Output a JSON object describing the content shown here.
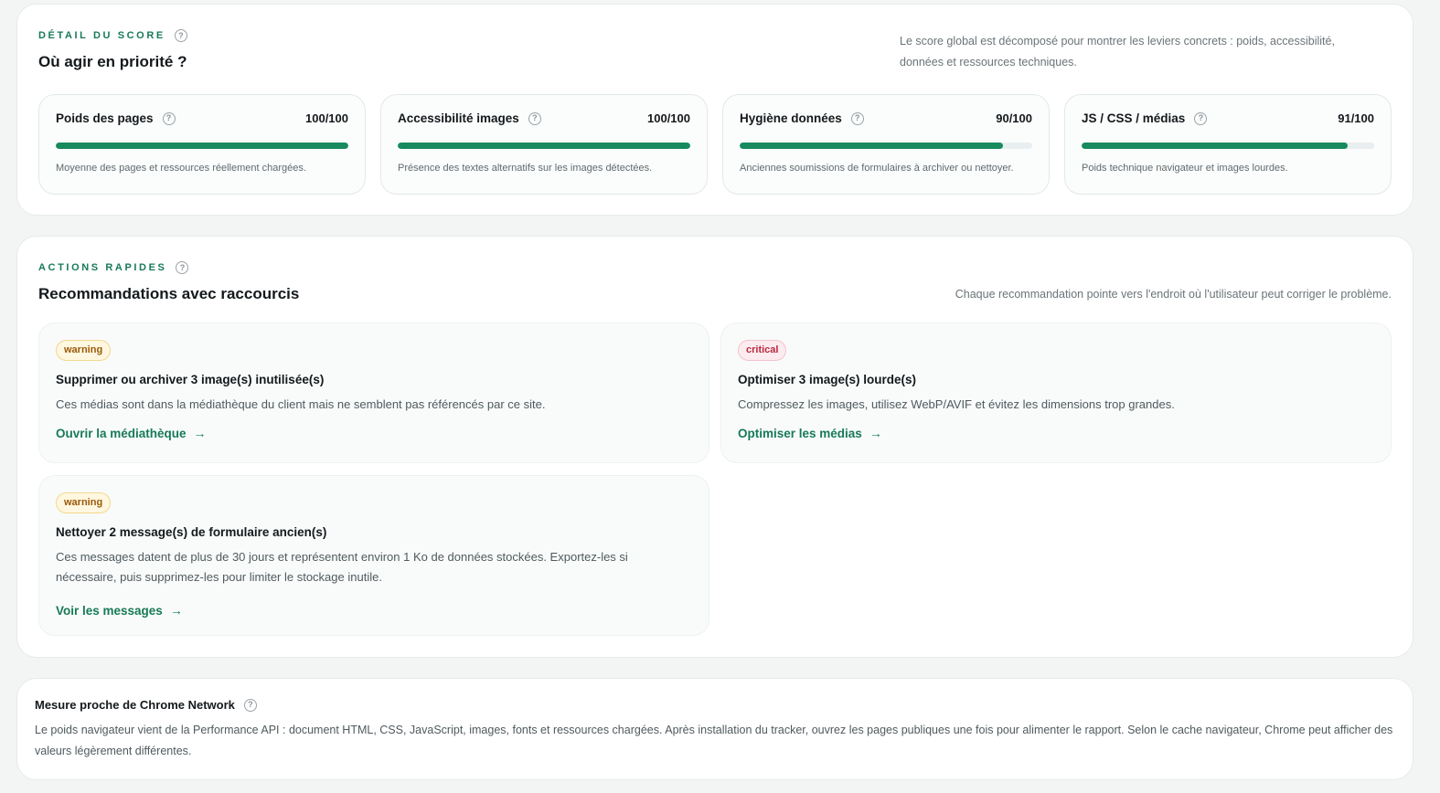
{
  "score_section": {
    "eyebrow": "DÉTAIL DU SCORE",
    "title": "Où agir en priorité ?",
    "description": "Le score global est décomposé pour montrer les leviers concrets : poids, accessibilité, données et ressources techniques.",
    "cards": [
      {
        "label": "Poids des pages",
        "value": "100/100",
        "score": 100,
        "description": "Moyenne des pages et ressources réellement chargées."
      },
      {
        "label": "Accessibilité images",
        "value": "100/100",
        "score": 100,
        "description": "Présence des textes alternatifs sur les images détectées."
      },
      {
        "label": "Hygiène données",
        "value": "90/100",
        "score": 90,
        "description": "Anciennes soumissions de formulaires à archiver ou nettoyer."
      },
      {
        "label": "JS / CSS / médias",
        "value": "91/100",
        "score": 91,
        "description": "Poids technique navigateur et images lourdes."
      }
    ]
  },
  "actions_section": {
    "eyebrow": "ACTIONS RAPIDES",
    "title": "Recommandations avec raccourcis",
    "description": "Chaque recommandation pointe vers l'endroit où l'utilisateur peut corriger le problème.",
    "cards": [
      {
        "badge": "warning",
        "title": "Supprimer ou archiver 3 image(s) inutilisée(s)",
        "description": "Ces médias sont dans la médiathèque du client mais ne semblent pas référencés par ce site.",
        "link": "Ouvrir la médiathèque"
      },
      {
        "badge": "critical",
        "title": "Optimiser 3 image(s) lourde(s)",
        "description": "Compressez les images, utilisez WebP/AVIF et évitez les dimensions trop grandes.",
        "link": "Optimiser les médias"
      },
      {
        "badge": "warning",
        "title": "Nettoyer 2 message(s) de formulaire ancien(s)",
        "description": "Ces messages datent de plus de 30 jours et représentent environ 1 Ko de données stockées. Exportez-les si nécessaire, puis supprimez-les pour limiter le stockage inutile.",
        "link": "Voir les messages"
      }
    ]
  },
  "chrome_section": {
    "title": "Mesure proche de Chrome Network",
    "description": "Le poids navigateur vient de la Performance API : document HTML, CSS, JavaScript, images, fonts et ressources chargées. Après installation du tracker, ouvrez les pages publiques une fois pour alimenter le rapport. Selon le cache navigateur, Chrome peut afficher des valeurs légèrement différentes."
  },
  "icons": {
    "help": "help-circle-icon",
    "arrow": "arrow-right-icon"
  },
  "colors": {
    "accent": "#177a56",
    "bar_fill": "#178a5e",
    "warning": "#9a5a0a",
    "critical": "#b8283f"
  }
}
